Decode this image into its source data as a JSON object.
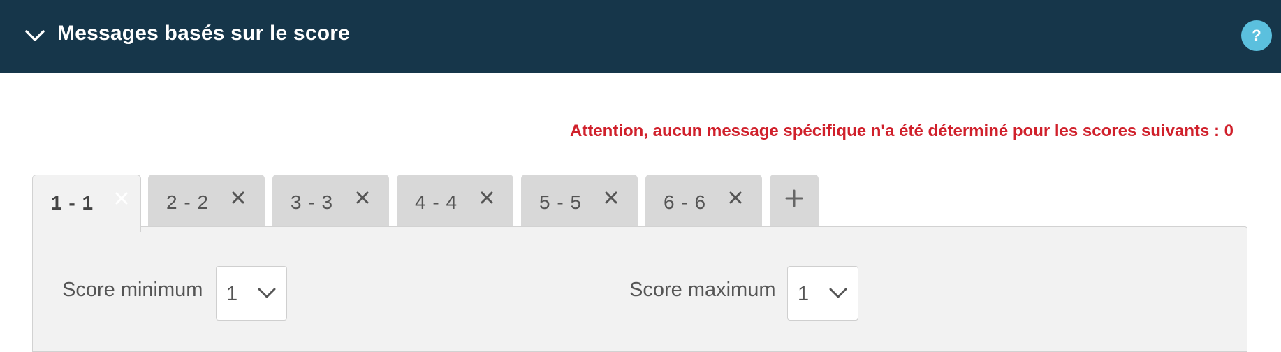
{
  "header": {
    "title": "Messages basés sur le score",
    "help_label": "?"
  },
  "warning": "Attention, aucun message spécifique n'a été déterminé pour les scores suivants : 0",
  "tabs": [
    {
      "label": "1 - 1",
      "active": true
    },
    {
      "label": "2 - 2",
      "active": false
    },
    {
      "label": "3 - 3",
      "active": false
    },
    {
      "label": "4 - 4",
      "active": false
    },
    {
      "label": "5 - 5",
      "active": false
    },
    {
      "label": "6 - 6",
      "active": false
    }
  ],
  "add_tab_icon": "plus-icon",
  "form": {
    "min_label": "Score minimum",
    "min_value": "1",
    "max_label": "Score maximum",
    "max_value": "1"
  },
  "colors": {
    "header_bg": "#16364a",
    "help_bg": "#5bc0de",
    "warning": "#d0202b",
    "tab_inactive": "#d8d8d8",
    "panel_bg": "#f2f2f2"
  }
}
